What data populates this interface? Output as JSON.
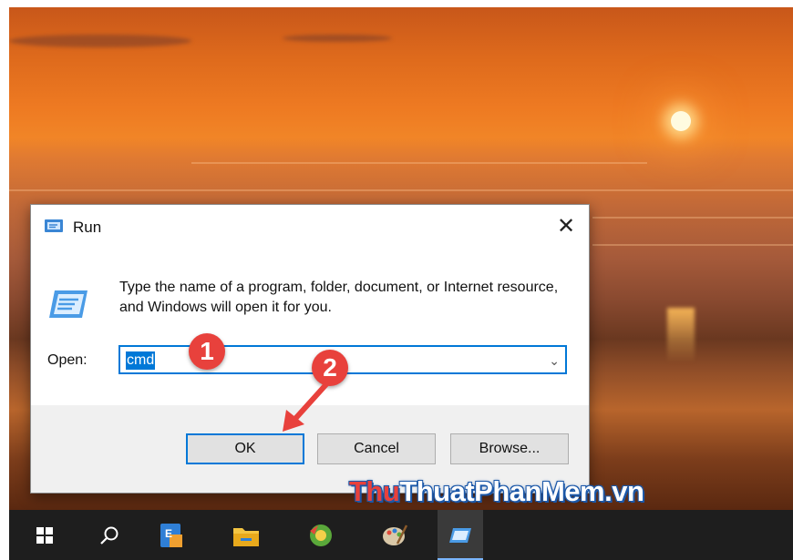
{
  "dialog": {
    "title": "Run",
    "description": "Type the name of a program, folder, document, or Internet resource, and Windows will open it for you.",
    "open_label": "Open:",
    "open_value": "cmd",
    "ok_label": "OK",
    "cancel_label": "Cancel",
    "browse_label": "Browse...",
    "close_symbol": "✕"
  },
  "annotations": {
    "step1": "1",
    "step2": "2"
  },
  "watermark": {
    "part1": "Thu",
    "part2": "ThuatPhanMem.vn"
  },
  "taskbar": {
    "items": [
      {
        "name": "start-button",
        "icon": "windows-logo-icon"
      },
      {
        "name": "search-button",
        "icon": "search-icon"
      },
      {
        "name": "app-outlook",
        "icon": "outlook-icon"
      },
      {
        "name": "app-file-explorer",
        "icon": "folder-icon"
      },
      {
        "name": "app-browser",
        "icon": "browser-icon"
      },
      {
        "name": "app-paint",
        "icon": "paint-palette-icon"
      },
      {
        "name": "app-run",
        "icon": "run-icon"
      }
    ]
  },
  "colors": {
    "accent": "#0078d7",
    "badge": "#e8413c",
    "taskbar": "#1e1e1e"
  }
}
